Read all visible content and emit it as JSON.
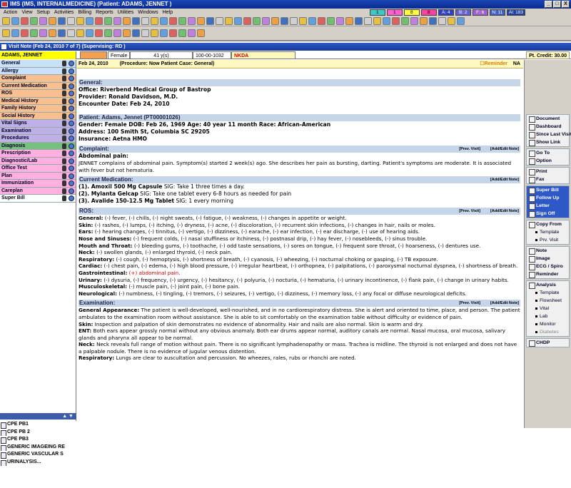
{
  "window": {
    "title": "IMS (IMS, INTERNALMEDICINE)    (Patient: ADAMS, JENNET )",
    "btns": [
      "_",
      "□",
      "X"
    ]
  },
  "menu": [
    "Action",
    "View",
    "Setup",
    "Activities",
    "Billing",
    "Reports",
    "Utilities",
    "Windows",
    "Help"
  ],
  "quick": [
    {
      "label": "1",
      "color": "#3dc8c8"
    },
    {
      "label": "1",
      "color": "#ff60d0"
    },
    {
      "label": "8",
      "color": "#ffff40"
    },
    {
      "label": "8",
      "color": "#ff40a0"
    },
    {
      "label": "A: 4",
      "color": "#3040c0"
    },
    {
      "label": "B: 2",
      "color": "#6060d0"
    },
    {
      "label": "F: 6",
      "color": "#a060d0"
    },
    {
      "label": "N: 11",
      "color": "#4060c0"
    },
    {
      "label": "Al: 183",
      "color": "#2040a0"
    }
  ],
  "visit_title": "Visit Note (Feb 24, 2010     7 of 7) (Supervising: RD )",
  "patient": {
    "name": "ADAMS, JENNET",
    "gender": "Female",
    "age": "41 y(s)",
    "id": "100-00-1032",
    "allergy": "NKDA",
    "credit": "Pt. Credit: 30.00"
  },
  "sidebar": [
    {
      "label": "General",
      "color": "#c8e0f8"
    },
    {
      "label": "Allergy",
      "color": "#c8e0f8"
    },
    {
      "label": "Complaint",
      "color": "#f8c090"
    },
    {
      "label": "Current Medication",
      "color": "#f8c090"
    },
    {
      "label": "ROS",
      "color": "#f8c090"
    },
    {
      "label": "Medical History",
      "color": "#f8c090"
    },
    {
      "label": "Family History",
      "color": "#f8c090"
    },
    {
      "label": "Social History",
      "color": "#f8c090"
    },
    {
      "label": "Vital Signs",
      "color": "#c0b0e8"
    },
    {
      "label": "Examination",
      "color": "#c0b0e8"
    },
    {
      "label": "Procedures",
      "color": "#c0b0e8"
    },
    {
      "label": "Diagnosis",
      "color": "#78c080"
    },
    {
      "label": "Prescription",
      "color": "#ffb0e0"
    },
    {
      "label": "Diagnostic/Lab",
      "color": "#ffb0e0"
    },
    {
      "label": "Office Test",
      "color": "#ffb0e0"
    },
    {
      "label": "Plan",
      "color": "#ffb0e0"
    },
    {
      "label": "Immunization",
      "color": "#ffb0e0"
    },
    {
      "label": "Careplan",
      "color": "#ffb0e0"
    },
    {
      "label": "Super Bill",
      "color": "#ffffff"
    }
  ],
  "arrows": "▲ ▼",
  "problem_list": [
    "CPE PB1",
    "CPE PB 2",
    "CPE PB3",
    "GENERIC IMAGEING RE",
    "GENERIC VASCULAR S",
    "URINALYSIS..."
  ],
  "main": {
    "header_date": "Feb 24, 2010",
    "header_info": "(Procedure:  Now Patient  Case: General)",
    "reminder": "Reminder",
    "na": "NA",
    "general_title": "General:",
    "office": "Office: Riverbend Medical Group of Bastrop",
    "provider": "Provider: Ronald Davidson, M.D.",
    "encounter": "Encounter Date: Feb 24, 2010",
    "patient_title": "Patient: Adams, Jennet    (PT00001026)",
    "gender_line": "Gender: Female     DOB: Feb 26, 1969     Age: 40 year 11 month      Race: African-American",
    "address": "Address: 100 Smith St, Columbia  SC  29205",
    "insurance": "Insurance: Aetna HMO",
    "complaint_title": "Complaint:",
    "prev_visit": "[Prev. Visit]",
    "add_edit": "[Add/Edit Note]",
    "complaint_sub": "Abdominal pain:",
    "complaint_text": "JENNET complains of abdominal pain. Symptom(s) started 2 week(s) ago. She describes her pain as bursting, darting. Patient's symptoms are moderate. It is associated with fever but not hematuria.",
    "med_title": "Current Medication:",
    "meds": [
      {
        "drug": "(1). Amoxil 500 Mg Capsule",
        "sig": "  SIG: Take 1 three times a day."
      },
      {
        "drug": "(2). Mylanta Gelcap",
        "sig": "  SIG: Take one tablet every 6-8 hours as needed for pain"
      },
      {
        "drug": "(3). Avalide 150-12.5 Mg Tablet",
        "sig": "  SIG: 1 every morning"
      }
    ],
    "ros_title": "ROS:",
    "ros": [
      {
        "k": "General:",
        "v": " (-) fever, (-) chills, (-) night sweats, (-) fatigue, (-) weakness, (-) changes in appetite or weight."
      },
      {
        "k": "Skin:",
        "v": " (-) rashes, (-) lumps, (-) itching, (-) dryness, (-) acne, (-) discoloration, (-) recurrent skin infections, (-) changes in hair, nails or moles."
      },
      {
        "k": "Ears:",
        "v": " (-) hearing changes, (-) tinnitus, (-) vertigo, (-) dizziness, (-) earache, (-) ear infection, (-) ear discharge, (-) use of hearing aids."
      },
      {
        "k": "Nose and Sinuses:",
        "v": " (-) frequent colds, (-) nasal stuffiness or itchiness, (-) postnasal drip, (-) hay fever, (-) nosebleeds, (-) sinus trouble."
      },
      {
        "k": "Mouth and Throat:",
        "v": " (-) bleeding gums, (-) toothache, (-) odd taste sensations, (-) sores on tongue, (-) frequent sore throat, (-) hoarseness, (-) dentures use."
      },
      {
        "k": "Neck:",
        "v": " (-) swollen glands, (-) enlarged thyroid, (-) neck pain."
      },
      {
        "k": "Respiratory:",
        "v": " (-) cough, (-) hemoptysis, (-) shortness of breath, (-) cyanosis, (-) wheezing, (-) nocturnal choking or gasping, (-) TB exposure."
      },
      {
        "k": "Cardiac:",
        "v": " (-) chest pain, (-) edema, (-) high blood pressure, (-) irregular heartbeat, (-) orthopnea, (-) palpitations, (-) paroxysmal nocturnal dyspnea, (-) shortness of breath."
      },
      {
        "k": "Gastrointestinal:",
        "v": " (+) abdominal pain.",
        "red": true
      },
      {
        "k": "Urinary:",
        "v": " (-) dysuria, (-) frequency, (-) urgency, (-) hesitancy, (-) polyuria, (-) nocturia, (-) hematuria, (-) urinary incontinence, (-) flank pain, (-) change in urinary habits."
      },
      {
        "k": "Musculoskeletal:",
        "v": " (-) muscle pain, (-) joint pain, (-) bone pain."
      },
      {
        "k": "Neurological:",
        "v": " (-) numbness, (-) tingling, (-) tremors, (-) seizures, (-) vertigo, (-) dizziness, (-) memory loss, (-) any focal or diffuse neurological deficits."
      }
    ],
    "exam_title": "Examination:",
    "exam": [
      {
        "k": "General Appearance:",
        "v": " The patient is well-developed, well-nourished, and in no cardiorespiratory distress. She is alert and oriented to time, place, and person. The patient ambulates to the examination room without assistance. She is able to sit comfortably on the examination table without difficulty or evidence of pain."
      },
      {
        "k": "Skin:",
        "v": " Inspection and palpation of skin demonstrates no evidence of abnormality. Hair and nails are also normal. Skin is warm and dry."
      },
      {
        "k": "ENT:",
        "v": " Both ears appear grossly normal without any obvious anomaly. Both ear drums appear normal, auditory canals are normal. Nasal mucosa, oral mucosa, salivary glands and pharynx all appear to be normal."
      },
      {
        "k": "Neck:",
        "v": " Neck reveals full range of motion without pain. There is no significant lymphadenopathy or mass. Trachea is midline. The thyroid is not enlarged and does not have a palpable nodule. There is no evidence of jugular venous distention."
      },
      {
        "k": "Respiratory:",
        "v": " Lungs are clear to auscultation and percussion. No wheezes, rales, rubs or rhonchi are noted."
      }
    ]
  },
  "right_panel": {
    "g1": [
      "Document",
      "Dashboard",
      "Since Last Visit",
      "Show Link"
    ],
    "g2": [
      "Go To",
      "Option"
    ],
    "g3": [
      "Print",
      "Fax"
    ],
    "g4": [
      "Super Bill",
      "Follow Up",
      "Letter",
      "Sign Off"
    ],
    "g5": [
      "Copy From"
    ],
    "g5sub": [
      "Template",
      "Prv. Visit"
    ],
    "g6": [
      "Note",
      "Image",
      "ECG / Spiro",
      "Reminder"
    ],
    "g7": [
      "Analysis"
    ],
    "g7sub": [
      "Template",
      "Flowsheet",
      "Vital",
      "Lab",
      "Monitor",
      "Diabetes"
    ],
    "g8": [
      "CHDP"
    ]
  }
}
